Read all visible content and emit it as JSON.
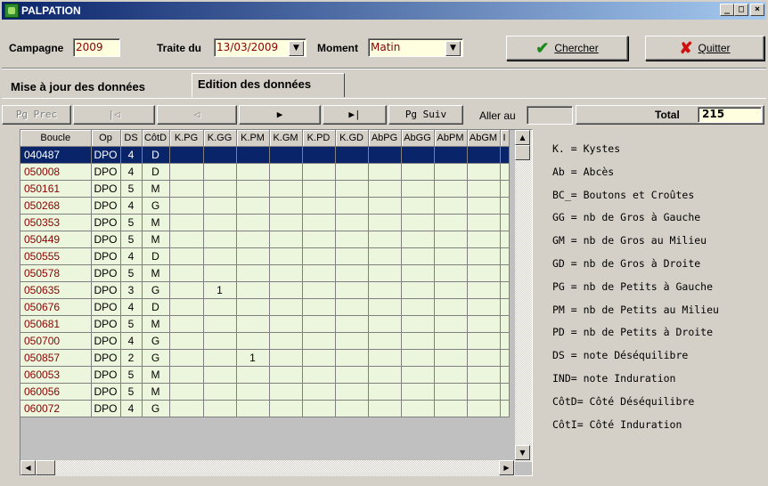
{
  "window": {
    "title": "PALPATION",
    "minimize_glyph": "_",
    "maximize_glyph": "□",
    "close_glyph": "×"
  },
  "header": {
    "campagne_label": "Campagne",
    "campagne_value": "2009",
    "traite_label": "Traite du",
    "traite_value": "13/03/2009",
    "moment_label": "Moment",
    "moment_value": "Matin",
    "dropdown_glyph": "▼",
    "search_label": "Chercher",
    "quit_label": "Quitter",
    "search_icon": "check-icon",
    "quit_icon": "x-icon"
  },
  "tabs": [
    {
      "label": "Mise à jour des données",
      "active": false
    },
    {
      "label": "Edition des données",
      "active": true
    }
  ],
  "nav": {
    "pg_prec": "Pg Prec",
    "first": "|◁",
    "prev": "◁",
    "next": "▶",
    "last": "▶|",
    "pg_suiv": "Pg Suiv",
    "aller_au_label": "Aller au",
    "aller_au_value": "",
    "total_label": "Total",
    "total_value": "215"
  },
  "grid": {
    "columns": [
      "Boucle",
      "Op",
      "DS",
      "CôtD",
      "K.PG",
      "K.GG",
      "K.PM",
      "K.GM",
      "K.PD",
      "K.GD",
      "AbPG",
      "AbGG",
      "AbPM",
      "AbGM",
      "I"
    ],
    "rows": [
      [
        "040487",
        "DPO",
        "4",
        "D",
        "",
        "",
        "",
        "",
        "",
        "",
        "",
        "",
        "",
        "",
        ""
      ],
      [
        "050008",
        "DPO",
        "4",
        "D",
        "",
        "",
        "",
        "",
        "",
        "",
        "",
        "",
        "",
        "",
        ""
      ],
      [
        "050161",
        "DPO",
        "5",
        "M",
        "",
        "",
        "",
        "",
        "",
        "",
        "",
        "",
        "",
        "",
        ""
      ],
      [
        "050268",
        "DPO",
        "4",
        "G",
        "",
        "",
        "",
        "",
        "",
        "",
        "",
        "",
        "",
        "",
        ""
      ],
      [
        "050353",
        "DPO",
        "5",
        "M",
        "",
        "",
        "",
        "",
        "",
        "",
        "",
        "",
        "",
        "",
        ""
      ],
      [
        "050449",
        "DPO",
        "5",
        "M",
        "",
        "",
        "",
        "",
        "",
        "",
        "",
        "",
        "",
        "",
        ""
      ],
      [
        "050555",
        "DPO",
        "4",
        "D",
        "",
        "",
        "",
        "",
        "",
        "",
        "",
        "",
        "",
        "",
        ""
      ],
      [
        "050578",
        "DPO",
        "5",
        "M",
        "",
        "",
        "",
        "",
        "",
        "",
        "",
        "",
        "",
        "",
        ""
      ],
      [
        "050635",
        "DPO",
        "3",
        "G",
        "",
        "1",
        "",
        "",
        "",
        "",
        "",
        "",
        "",
        "",
        ""
      ],
      [
        "050676",
        "DPO",
        "4",
        "D",
        "",
        "",
        "",
        "",
        "",
        "",
        "",
        "",
        "",
        "",
        ""
      ],
      [
        "050681",
        "DPO",
        "5",
        "M",
        "",
        "",
        "",
        "",
        "",
        "",
        "",
        "",
        "",
        "",
        ""
      ],
      [
        "050700",
        "DPO",
        "4",
        "G",
        "",
        "",
        "",
        "",
        "",
        "",
        "",
        "",
        "",
        "",
        ""
      ],
      [
        "050857",
        "DPO",
        "2",
        "G",
        "",
        "",
        "1",
        "",
        "",
        "",
        "",
        "",
        "",
        "",
        ""
      ],
      [
        "060053",
        "DPO",
        "5",
        "M",
        "",
        "",
        "",
        "",
        "",
        "",
        "",
        "",
        "",
        "",
        ""
      ],
      [
        "060056",
        "DPO",
        "5",
        "M",
        "",
        "",
        "",
        "",
        "",
        "",
        "",
        "",
        "",
        "",
        ""
      ],
      [
        "060072",
        "DPO",
        "4",
        "G",
        "",
        "",
        "",
        "",
        "",
        "",
        "",
        "",
        "",
        "",
        ""
      ]
    ],
    "selected_row": 0
  },
  "legend": [
    "K. = Kystes",
    "Ab = Abcès",
    "BC_= Boutons et Croûtes",
    "GG = nb de Gros à Gauche",
    "GM = nb de Gros au Milieu",
    "GD = nb de Gros à Droite",
    "PG = nb de Petits à Gauche",
    "PM = nb de Petits au Milieu",
    "PD = nb de Petits à Droite",
    "DS = note Déséquilibre",
    "IND= note Induration",
    "CôtD= Côté Déséquilibre",
    "CôtI= Côté Induration"
  ],
  "colors": {
    "titlebar": "#0a246a",
    "grid_bg": "#ecf6dd",
    "field_bg": "#ffffe0",
    "code_text": "#8b0000",
    "selection": "#0a246a"
  }
}
